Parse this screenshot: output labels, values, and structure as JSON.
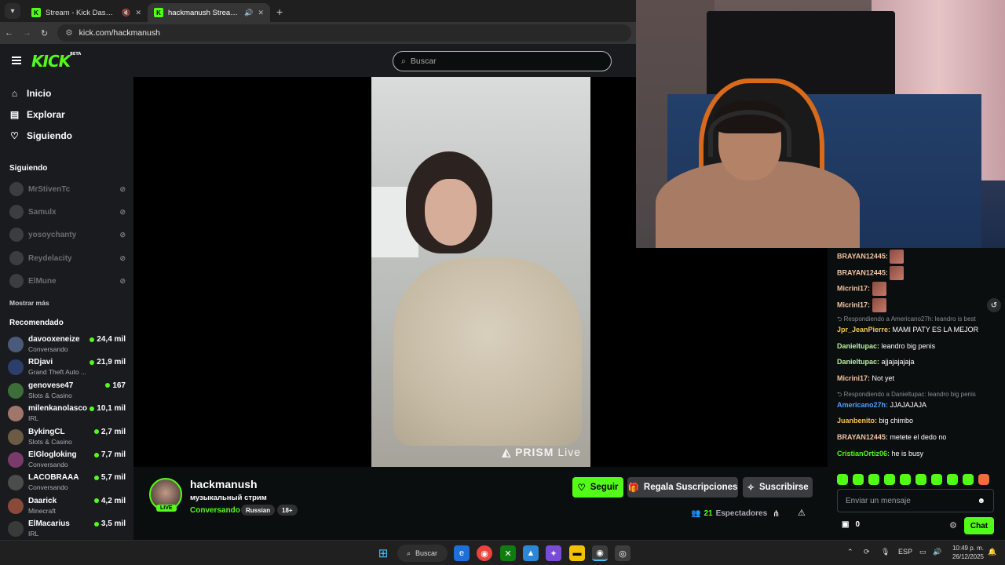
{
  "browser": {
    "tabs": [
      {
        "title": "Stream - Kick Dashboard",
        "active": false
      },
      {
        "title": "hackmanush Stream - Watch",
        "active": true
      }
    ],
    "new_tab_symbol": "+",
    "url": "kick.com/hackmanush"
  },
  "kick": {
    "logo": "KICK",
    "logo_badge": "BETA",
    "search_placeholder": "Buscar",
    "nav": [
      {
        "label": "Inicio",
        "icon": "home-icon"
      },
      {
        "label": "Explorar",
        "icon": "explore-icon"
      },
      {
        "label": "Siguiendo",
        "icon": "heart-icon"
      }
    ],
    "following_title": "Siguiendo",
    "following": [
      "MrStivenTc",
      "Samulx",
      "yosoychanty",
      "Reydelacity",
      "ElMune"
    ],
    "show_more": "Mostrar más",
    "recommended_title": "Recomendado",
    "recommended": [
      {
        "name": "davooxeneize",
        "category": "Conversando",
        "viewers": "24,4 mil",
        "color": "#4a5a7a"
      },
      {
        "name": "RDjavi",
        "category": "Grand Theft Auto ...",
        "viewers": "21,9 mil",
        "color": "#2c3f6b"
      },
      {
        "name": "genovese47",
        "category": "Slots & Casino",
        "viewers": "167",
        "color": "#3d6e3a"
      },
      {
        "name": "milenkanolasco",
        "category": "IRL",
        "viewers": "10,1 mil",
        "color": "#a0766a"
      },
      {
        "name": "BykingCL",
        "category": "Slots & Casino",
        "viewers": "2,7 mil",
        "color": "#6b5a44"
      },
      {
        "name": "ElGlogloking",
        "category": "Conversando",
        "viewers": "7,7 mil",
        "color": "#7a3b6a"
      },
      {
        "name": "LACOBRAAA",
        "category": "Conversando",
        "viewers": "5,7 mil",
        "color": "#4c4c4c"
      },
      {
        "name": "Daarick",
        "category": "Minecraft",
        "viewers": "4,2 mil",
        "color": "#8a4a3a"
      },
      {
        "name": "ElMacarius",
        "category": "IRL",
        "viewers": "3,5 mil",
        "color": "#3a3a3a"
      }
    ]
  },
  "video": {
    "watermark_brand": "PRISM",
    "watermark_word": "Live"
  },
  "channel": {
    "name": "hackmanush",
    "live_badge": "LIVE",
    "stream_title": "музыкальный стрим",
    "category": "Conversando",
    "tags": [
      "Russian",
      "18+"
    ],
    "follow_label": "Seguir",
    "gift_label": "Regala Suscripciones",
    "subscribe_label": "Suscribirse",
    "viewers_count": "21",
    "viewers_label": "Espectadores"
  },
  "chat": {
    "messages": [
      {
        "type": "emote",
        "user": "BRAYAN12445:",
        "color": "#f3c4a0"
      },
      {
        "type": "emote",
        "user": "BRAYAN12445:",
        "color": "#f3c4a0"
      },
      {
        "type": "emote",
        "user": "Micrini17:",
        "color": "#f3c4a0"
      },
      {
        "type": "emote",
        "user": "Micrini17:",
        "color": "#f3c4a0"
      },
      {
        "type": "reply",
        "text": "Respondiendo a Americano27h: leandro is best"
      },
      {
        "type": "text",
        "user": "Jpr_JeanPierre:",
        "text": " MAMI PATY ES LA MEJOR",
        "color": "#f5c453"
      },
      {
        "type": "text",
        "user": "Danieltupac:",
        "text": " leandro big penis",
        "color": "#bff0a0"
      },
      {
        "type": "text",
        "user": "Danieltupac:",
        "text": " ajjajajajaja",
        "color": "#bff0a0"
      },
      {
        "type": "text",
        "user": "Micrini17:",
        "text": " Not yet",
        "color": "#f3c4a0"
      },
      {
        "type": "reply",
        "text": "Respondiendo a Danieltupac: leandro big penis"
      },
      {
        "type": "text",
        "user": "Americano27h:",
        "text": " JJAJAJAJA",
        "color": "#4fa0ff"
      },
      {
        "type": "text",
        "user": "Juanbenito:",
        "text": " big chimbo",
        "color": "#f5c453"
      },
      {
        "type": "text",
        "user": "BRAYAN12445:",
        "text": " metete el dedo no",
        "color": "#f3c4a0"
      },
      {
        "type": "text",
        "user": "CristianOrtiz06:",
        "text": " he is busy",
        "color": "#53fc18"
      }
    ],
    "input_placeholder": "Enviar un mensaje",
    "points": "0",
    "send_label": "Chat"
  },
  "taskbar": {
    "search_label": "Buscar",
    "lang": "ESP",
    "time": "10:49 p. m.",
    "date": "26/12/2025"
  }
}
